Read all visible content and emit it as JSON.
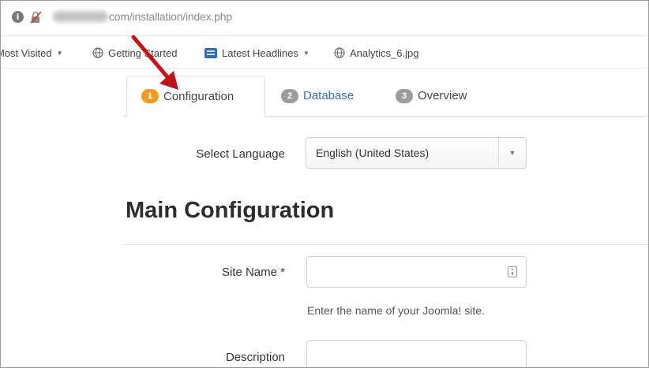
{
  "browser": {
    "url_path": "com/installation/index.php"
  },
  "bookmarks": [
    {
      "label": "Most Visited",
      "icon": "none",
      "dropdown": true
    },
    {
      "label": "Getting Started",
      "icon": "globe-icon",
      "dropdown": false
    },
    {
      "label": "Latest Headlines",
      "icon": "news-icon",
      "dropdown": true
    },
    {
      "label": "Analytics_6.jpg",
      "icon": "globe-icon",
      "dropdown": false
    }
  ],
  "tabs": [
    {
      "step": "1",
      "label": "Configuration",
      "active": true
    },
    {
      "step": "2",
      "label": "Database",
      "active": false
    },
    {
      "step": "3",
      "label": "Overview",
      "active": false
    }
  ],
  "language": {
    "label": "Select Language",
    "selected": "English (United States)"
  },
  "main": {
    "heading": "Main Configuration"
  },
  "form": {
    "site_name_label": "Site Name *",
    "site_name_value": "",
    "site_name_help": "Enter the name of your Joomla! site.",
    "description_label": "Description",
    "description_value": ""
  },
  "colors": {
    "active_step_badge": "#f29b1d",
    "inactive_step_badge": "#9c9c9c",
    "link_tab": "#2e6fc2",
    "annotation_arrow": "#c0141b"
  }
}
